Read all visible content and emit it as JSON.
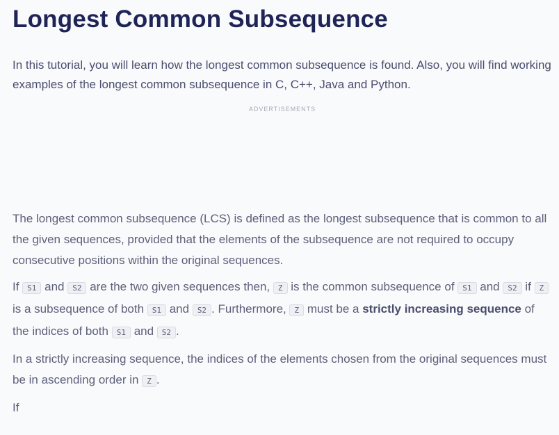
{
  "title": "Longest Common Subsequence",
  "intro": "In this tutorial, you will learn how the longest common subsequence is found. Also, you will find working examples of the longest common subsequence in C, C++, Java and Python.",
  "ads_label": "ADVERTISEMENTS",
  "paragraphs": [
    [
      {
        "t": "text",
        "v": "The longest common subsequence (LCS) is defined as the longest subsequence that is common to all the given sequences, provided that the elements of the subsequence are not required to occupy consecutive positions within the original sequences."
      }
    ],
    [
      {
        "t": "text",
        "v": "If "
      },
      {
        "t": "code",
        "v": "S1"
      },
      {
        "t": "text",
        "v": " and "
      },
      {
        "t": "code",
        "v": "S2"
      },
      {
        "t": "text",
        "v": " are the two given sequences then, "
      },
      {
        "t": "code",
        "v": "Z"
      },
      {
        "t": "text",
        "v": " is the common subsequence of "
      },
      {
        "t": "code",
        "v": "S1"
      },
      {
        "t": "text",
        "v": " and "
      },
      {
        "t": "code",
        "v": "S2"
      },
      {
        "t": "text",
        "v": " if "
      },
      {
        "t": "code",
        "v": "Z"
      },
      {
        "t": "text",
        "v": " is a subsequence of both "
      },
      {
        "t": "code",
        "v": "S1"
      },
      {
        "t": "text",
        "v": " and "
      },
      {
        "t": "code",
        "v": "S2"
      },
      {
        "t": "text",
        "v": ". Furthermore, "
      },
      {
        "t": "code",
        "v": "Z"
      },
      {
        "t": "text",
        "v": " must be a "
      },
      {
        "t": "bold",
        "v": "strictly increasing sequence"
      },
      {
        "t": "text",
        "v": " of the indices of both "
      },
      {
        "t": "code",
        "v": "S1"
      },
      {
        "t": "text",
        "v": " and "
      },
      {
        "t": "code",
        "v": "S2"
      },
      {
        "t": "text",
        "v": "."
      }
    ],
    [
      {
        "t": "text",
        "v": "In a strictly increasing sequence, the indices of the elements chosen from the original sequences must be in ascending order in "
      },
      {
        "t": "code",
        "v": "Z"
      },
      {
        "t": "text",
        "v": "."
      }
    ],
    [
      {
        "t": "text",
        "v": "If"
      }
    ]
  ]
}
